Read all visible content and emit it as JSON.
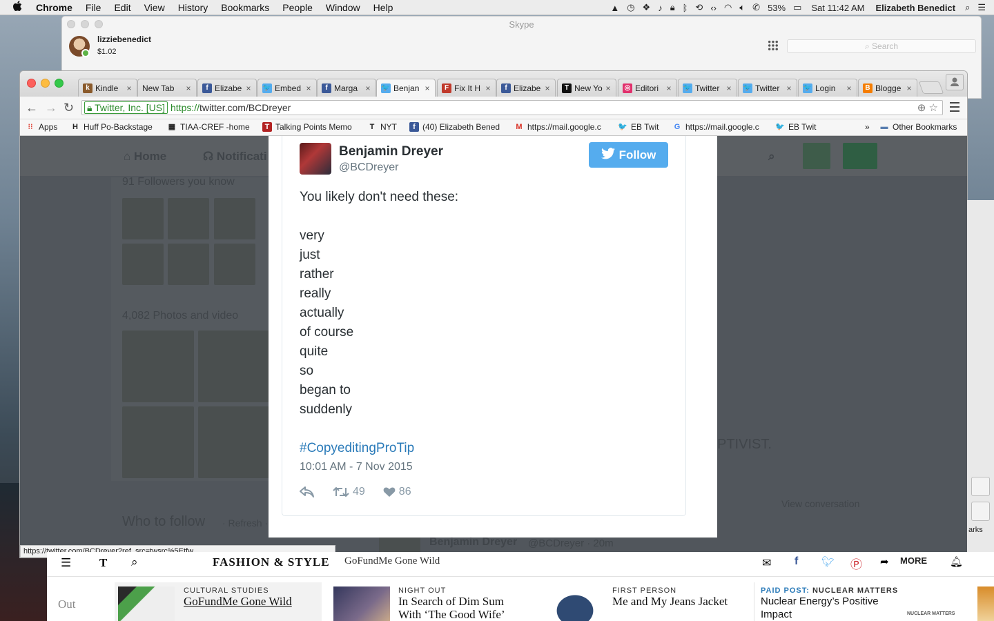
{
  "menubar": {
    "app": "Chrome",
    "items": [
      "File",
      "Edit",
      "View",
      "History",
      "Bookmarks",
      "People",
      "Window",
      "Help"
    ],
    "battery": "53%",
    "clock": "Sat 11:42 AM",
    "user": "Elizabeth  Benedict"
  },
  "skype": {
    "title": "Skype",
    "username": "lizziebenedict",
    "credit": "$1.02",
    "search_placeholder": "Search"
  },
  "chrome": {
    "tabs": [
      {
        "label": "Kindle",
        "icon": "kindle-icon",
        "color": "#8a5a2b",
        "glyph": "k"
      },
      {
        "label": "New Tab",
        "icon": "",
        "color": "",
        "glyph": ""
      },
      {
        "label": "Elizabe",
        "icon": "facebook-icon",
        "color": "#3b5998",
        "glyph": "f"
      },
      {
        "label": "Embed",
        "icon": "twitter-icon",
        "color": "#55acee",
        "glyph": "🐦"
      },
      {
        "label": "Marga",
        "icon": "facebook-icon",
        "color": "#3b5998",
        "glyph": "f"
      },
      {
        "label": "Benjan",
        "icon": "twitter-icon",
        "color": "#55acee",
        "glyph": "🐦",
        "active": true
      },
      {
        "label": "Fix It H",
        "icon": "fixit-icon",
        "color": "#c0392b",
        "glyph": "F"
      },
      {
        "label": "Elizabe",
        "icon": "facebook-icon",
        "color": "#3b5998",
        "glyph": "f"
      },
      {
        "label": "New Yo",
        "icon": "nyt-icon",
        "color": "#111111",
        "glyph": "T"
      },
      {
        "label": "Editori",
        "icon": "instagram-icon",
        "color": "#e1306c",
        "glyph": "◎"
      },
      {
        "label": "Twitter",
        "icon": "twitter-icon",
        "color": "#55acee",
        "glyph": "🐦"
      },
      {
        "label": "Twitter",
        "icon": "twitter-icon",
        "color": "#55acee",
        "glyph": "🐦"
      },
      {
        "label": "Login",
        "icon": "twitter-icon",
        "color": "#55acee",
        "glyph": "🐦"
      },
      {
        "label": "Blogge",
        "icon": "blogger-icon",
        "color": "#f57d00",
        "glyph": "B"
      }
    ],
    "ev_label": "Twitter, Inc. [US]",
    "url_scheme": "https://",
    "url_rest": "twitter.com/BCDreyer",
    "bookmarks": [
      {
        "label": "Apps",
        "icon": "apps-icon",
        "color": "#e04a3f",
        "glyph": "⁝⁝"
      },
      {
        "label": "Huff Po-Backstage",
        "icon": "huffpost-icon",
        "color": "#ffffff",
        "glyph": "H"
      },
      {
        "label": "TIAA-CREF -home",
        "icon": "tiaa-icon",
        "color": "#ffffff",
        "glyph": "▦"
      },
      {
        "label": "Talking Points Memo",
        "icon": "tpm-icon",
        "color": "#b22222",
        "glyph": "T"
      },
      {
        "label": "NYT",
        "icon": "nyt-icon",
        "color": "#ffffff",
        "glyph": "T"
      },
      {
        "label": "(40) Elizabeth Bened",
        "icon": "facebook-icon",
        "color": "#3b5998",
        "glyph": "f"
      },
      {
        "label": "https://mail.google.c",
        "icon": "gmail-icon",
        "color": "#ffffff",
        "glyph": "M"
      },
      {
        "label": "EB Twit",
        "icon": "twitter-icon",
        "color": "#ffffff",
        "glyph": "🐦"
      },
      {
        "label": "https://mail.google.c",
        "icon": "google-icon",
        "color": "#ffffff",
        "glyph": "G"
      },
      {
        "label": "EB Twit",
        "icon": "twitter-icon",
        "color": "#ffffff",
        "glyph": "🐦"
      }
    ],
    "overflow": "»",
    "other_bookmarks": "Other Bookmarks",
    "status_url": "https://twitter.com/BCDreyer?ref_src=twsrc%5Etfw"
  },
  "twitter_bg": {
    "home": "Home",
    "notifications": "Notificati",
    "followers_known": "91 Followers you know",
    "photos": "4,082 Photos and video",
    "who_to_follow": "Who to follow",
    "refresh": "· Refresh ·",
    "ptivist": "PTIVIST.",
    "view_conversation": "View conversation",
    "bg_tweet_name": "Benjamin Dreyer",
    "bg_tweet_meta": "@BCDreyer · 20m",
    "marks": "arks"
  },
  "tweet": {
    "name": "Benjamin Dreyer",
    "handle": "@BCDreyer",
    "follow_label": "Follow",
    "intro": "You likely don't need these:",
    "words": [
      "very",
      "just",
      "rather",
      "really",
      "actually",
      "of course",
      "quite",
      "so",
      "began to",
      "suddenly"
    ],
    "hashtag": "#CopyeditingProTip",
    "timestamp": "10:01 AM - 7 Nov 2015",
    "retweets": "49",
    "likes": "86"
  },
  "nyt": {
    "section": "FASHION & STYLE",
    "story": "GoFundMe Gone Wild",
    "more": "MORE",
    "out": "Out",
    "cards": [
      {
        "kicker": "CULTURAL STUDIES",
        "headline": "GoFundMe Gone Wild"
      },
      {
        "kicker": "NIGHT OUT",
        "headline": "In Search of Dim Sum With ‘The Good Wife’"
      },
      {
        "kicker": "FIRST PERSON",
        "headline": "Me and My Jeans Jacket"
      },
      {
        "kicker_prefix": "PAID POST:",
        "kicker": "NUCLEAR MATTERS",
        "headline": "Nuclear Energy’s Positive Impact",
        "sponsor": "NUCLEAR MATTERS"
      }
    ]
  }
}
